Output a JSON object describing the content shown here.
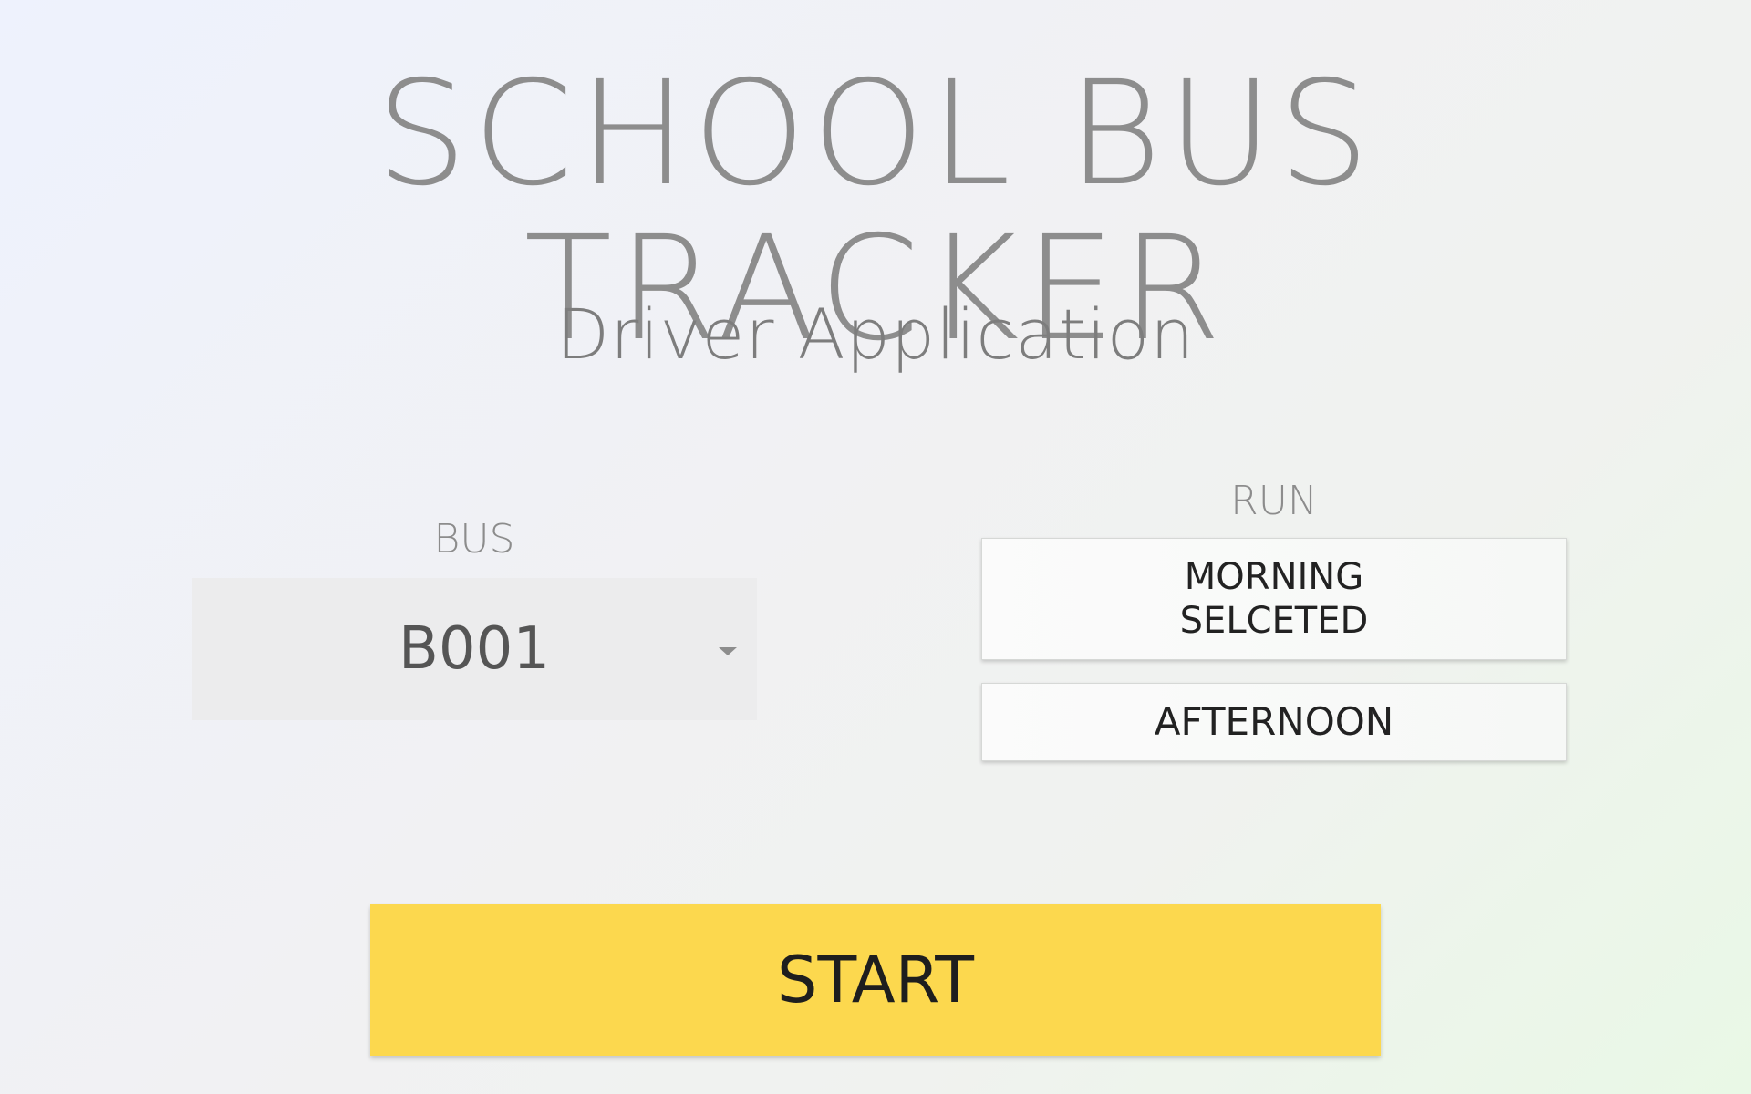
{
  "header": {
    "title": "SCHOOL BUS TRACKER",
    "subtitle": "Driver Application"
  },
  "bus": {
    "label": "BUS",
    "selected_value": "B001",
    "caret_icon": "caret-down-icon"
  },
  "run": {
    "label": "RUN",
    "options": [
      {
        "line1": "MORNING",
        "line2": "SELCETED"
      },
      {
        "line1": "AFTERNOON"
      }
    ]
  },
  "actions": {
    "start_label": "START",
    "start_color": "#fcd84e"
  }
}
